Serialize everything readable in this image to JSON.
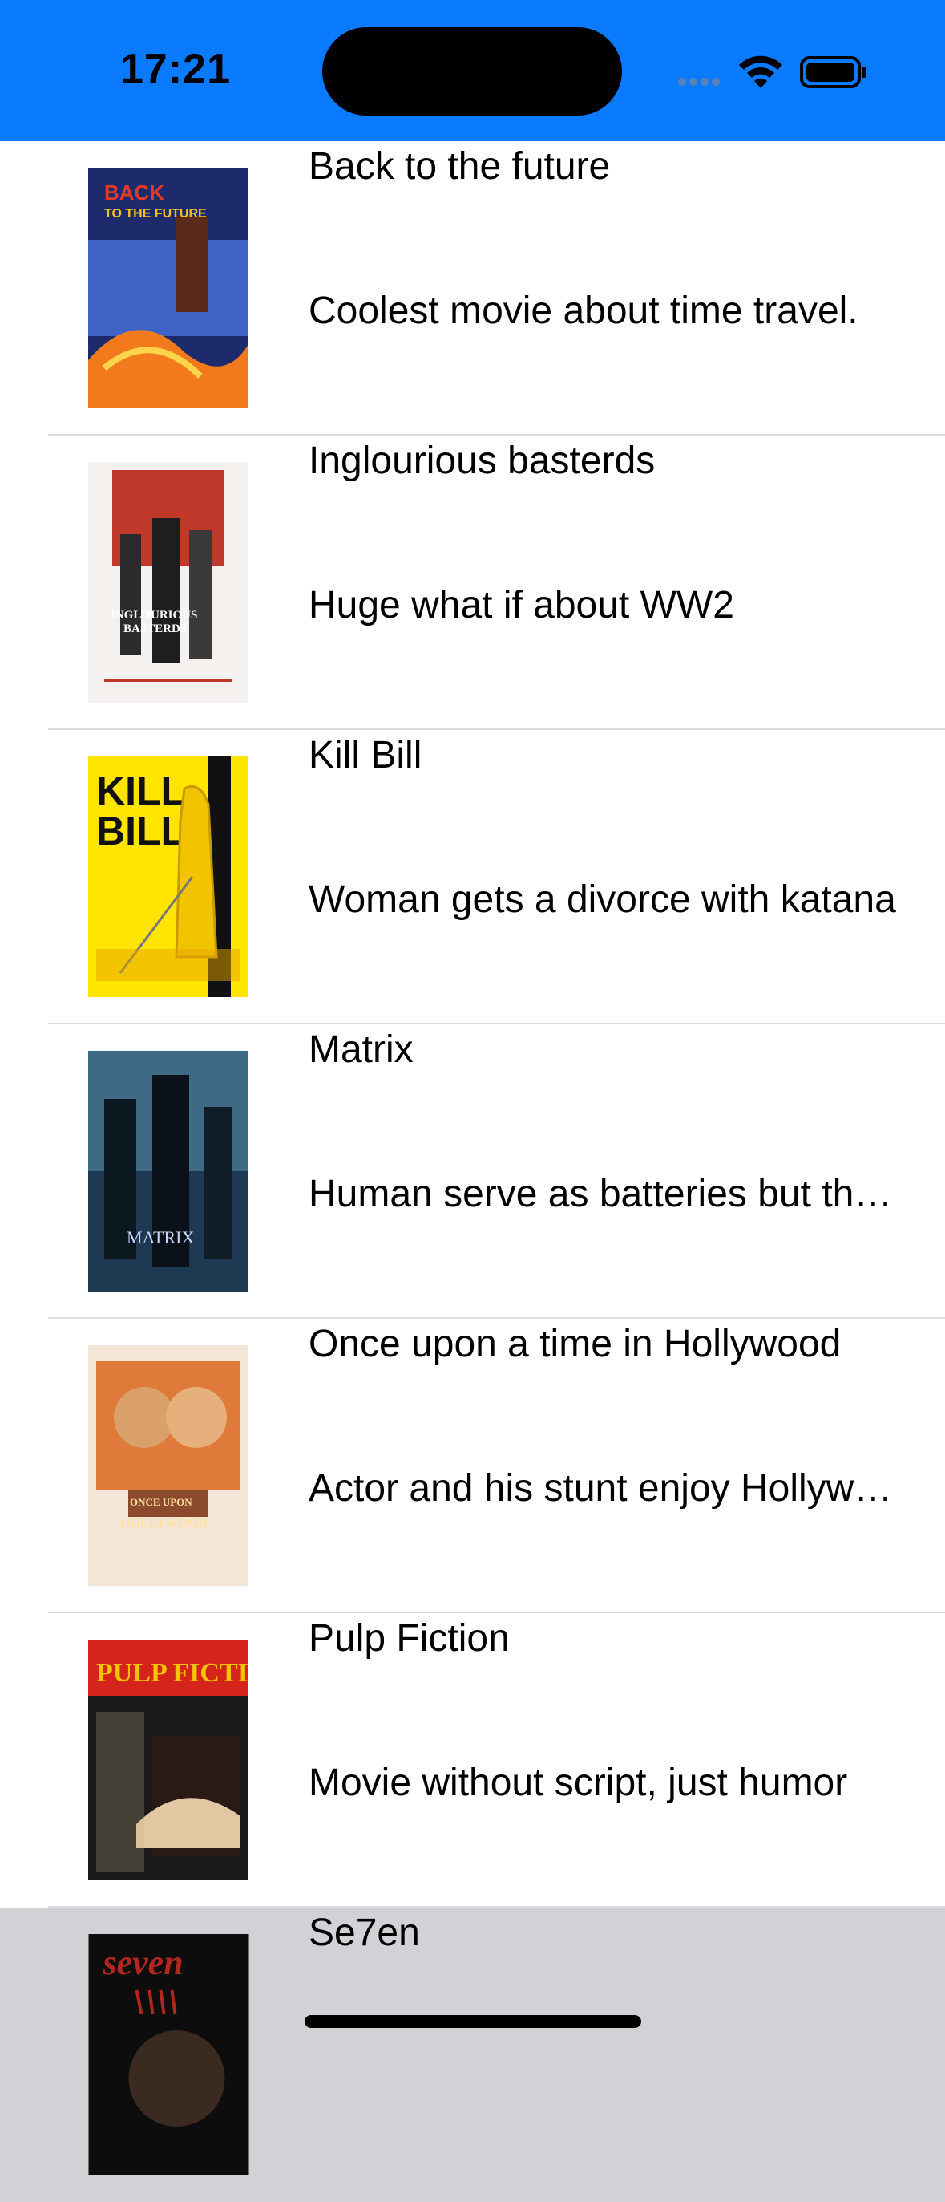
{
  "status_bar": {
    "time": "17:21",
    "background": "#0a7aff"
  },
  "movies": [
    {
      "title": "Back to the future",
      "description": "Coolest movie about time travel.",
      "poster_label": "BACK TO THE FUTURE",
      "poster_colors": [
        "#1d2a6b",
        "#3d63c6",
        "#f27a1c"
      ]
    },
    {
      "title": "Inglourious basterds",
      "description": "Huge what if about WW2",
      "poster_label": "INGLOURIOUS BASTERDS",
      "poster_colors": [
        "#f4f1ee",
        "#c0392b",
        "#2b2b2b"
      ]
    },
    {
      "title": "Kill Bill",
      "description": "Woman gets a divorce with katana",
      "poster_label": "KILL BILL",
      "poster_colors": [
        "#ffe400",
        "#f2c400",
        "#111111"
      ]
    },
    {
      "title": "Matrix",
      "description": "Human serve as batteries but they fight back",
      "poster_label": "MATRIX",
      "poster_colors": [
        "#1e3a52",
        "#3f6a86",
        "#0c1820"
      ]
    },
    {
      "title": "Once upon a time in Hollywood",
      "description": "Actor and his stunt enjoy Hollywood",
      "poster_label": "ONCE UPON A TIME IN HOLLYWOOD",
      "poster_colors": [
        "#f3e6d6",
        "#e07a3b",
        "#8b4a2b"
      ]
    },
    {
      "title": "Pulp Fiction",
      "description": "Movie without script, just humor",
      "poster_label": "PULP FICTION",
      "poster_colors": [
        "#d4241c",
        "#f5c400",
        "#1a1a1a"
      ]
    },
    {
      "title": "Se7en",
      "description": "",
      "poster_label": "seven",
      "poster_colors": [
        "#0d0d0d",
        "#b3261e",
        "#3a2a20"
      ]
    }
  ]
}
